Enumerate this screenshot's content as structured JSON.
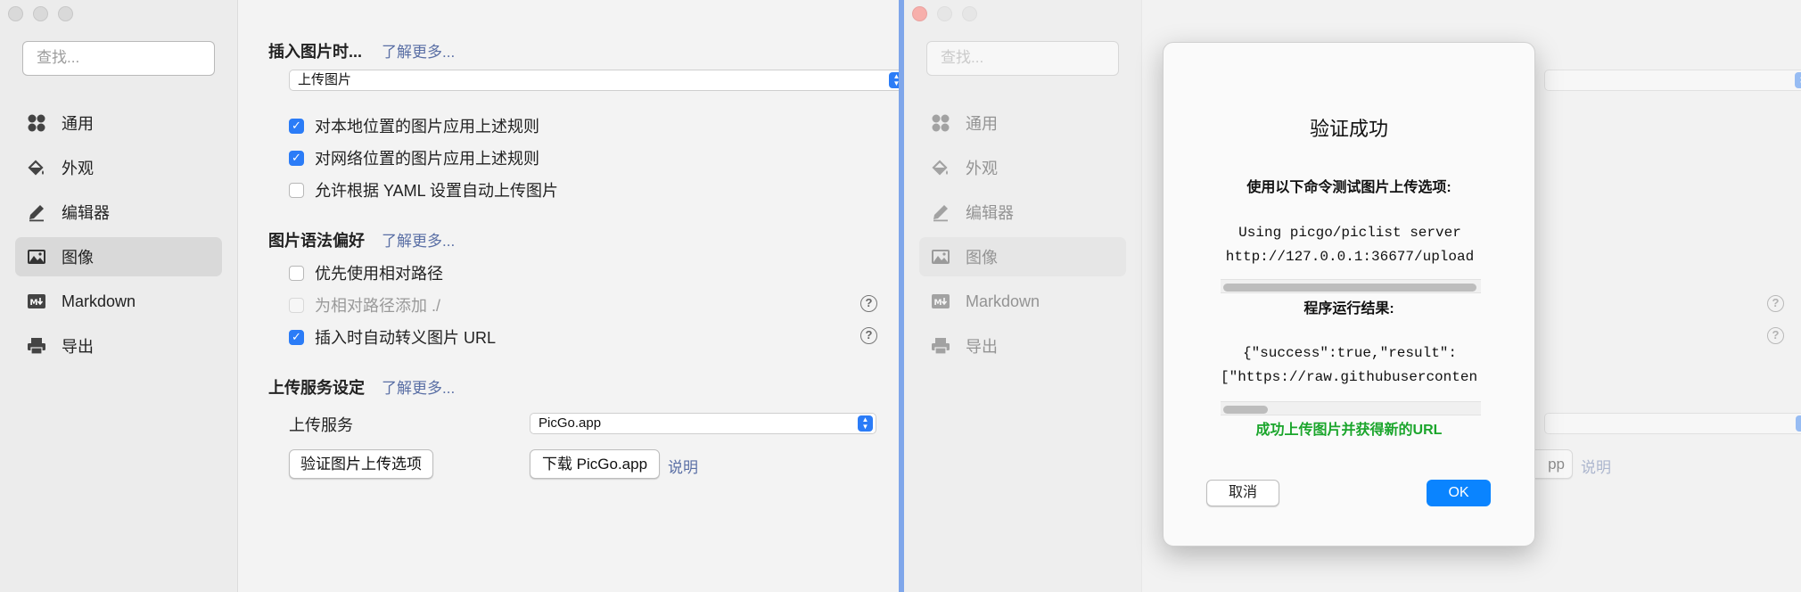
{
  "sidebar": {
    "search_placeholder": "查找...",
    "items": [
      {
        "label": "通用",
        "icon": "grid-icon"
      },
      {
        "label": "外观",
        "icon": "paint-bucket-icon"
      },
      {
        "label": "编辑器",
        "icon": "pencil-icon"
      },
      {
        "label": "图像",
        "icon": "image-icon",
        "active": true
      },
      {
        "label": "Markdown",
        "icon": "markdown-icon"
      },
      {
        "label": "导出",
        "icon": "printer-icon"
      }
    ]
  },
  "main": {
    "insert_section": {
      "title": "插入图片时...",
      "learn_more": "了解更多...",
      "select_value": "上传图片",
      "options": [
        {
          "label": "对本地位置的图片应用上述规则",
          "checked": true
        },
        {
          "label": "对网络位置的图片应用上述规则",
          "checked": true
        },
        {
          "label": "允许根据 YAML 设置自动上传图片",
          "checked": false
        }
      ]
    },
    "syntax_section": {
      "title": "图片语法偏好",
      "learn_more": "了解更多...",
      "options": [
        {
          "label": "优先使用相对路径",
          "checked": false
        },
        {
          "label": "为相对路径添加 ./",
          "checked": false,
          "disabled": true
        },
        {
          "label": "插入时自动转义图片 URL",
          "checked": true
        }
      ],
      "help_glyph": "?"
    },
    "upload_section": {
      "title": "上传服务设定",
      "learn_more": "了解更多...",
      "service_label": "上传服务",
      "service_value": "PicGo.app",
      "verify_button": "验证图片上传选项",
      "download_button": "下载 PicGo.app",
      "explain_link": "说明"
    }
  },
  "right_window": {
    "partial_button": "pp",
    "explain_link": "说明"
  },
  "dialog": {
    "title": "验证成功",
    "message": "使用以下命令测试图片上传选项:",
    "command_lines": [
      "Using picgo/piclist server",
      "http://127.0.0.1:36677/upload"
    ],
    "result_label": "程序运行结果:",
    "result_lines": [
      "{\"success\":true,\"result\":",
      "[\"https://raw.githubuserconten"
    ],
    "success_text": "成功上传图片并获得新的URL",
    "cancel_button": "取消",
    "ok_button": "OK"
  },
  "colors": {
    "accent": "#2b7cf7",
    "link": "#5a6fa5",
    "success": "#1aa52b",
    "close_button": "#fe5f57"
  }
}
